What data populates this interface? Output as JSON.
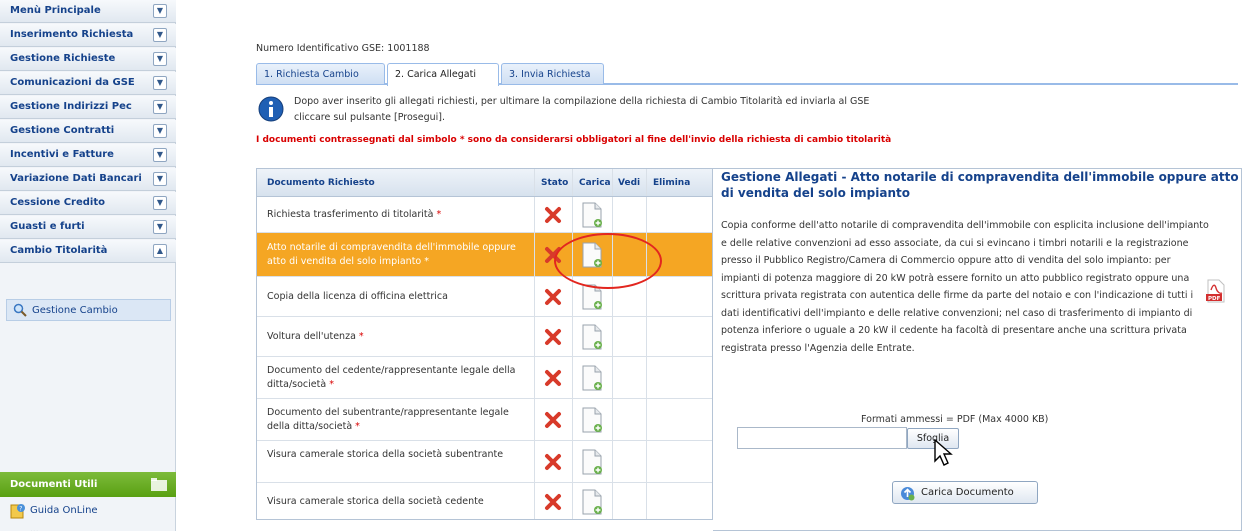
{
  "sidebar": {
    "items": [
      {
        "label": "Menù Principale",
        "expand": "▼"
      },
      {
        "label": "Inserimento Richiesta",
        "expand": "▼"
      },
      {
        "label": "Gestione Richieste",
        "expand": "▼"
      },
      {
        "label": "Comunicazioni da GSE",
        "expand": "▼"
      },
      {
        "label": "Gestione Indirizzi Pec",
        "expand": "▼"
      },
      {
        "label": "Gestione Contratti",
        "expand": "▼"
      },
      {
        "label": "Incentivi e Fatture",
        "expand": "▼"
      },
      {
        "label": "Variazione Dati Bancari",
        "expand": "▼"
      },
      {
        "label": "Cessione Credito",
        "expand": "▼"
      },
      {
        "label": "Guasti e furti",
        "expand": "▼"
      },
      {
        "label": "Cambio Titolarità",
        "expand": "▲"
      }
    ],
    "subitem": "Gestione Cambio",
    "docs_header": "Documenti Utili",
    "guide_link": "Guida OnLine",
    "extra_link": "..."
  },
  "main": {
    "gse_id": "Numero Identificativo GSE: 1001188",
    "tabs": [
      {
        "label": "1. Richiesta Cambio"
      },
      {
        "label": "2. Carica Allegati"
      },
      {
        "label": "3. Invia Richiesta"
      }
    ],
    "info_line1": "Dopo aver inserito gli allegati richiesti, per ultimare la compilazione della richiesta di Cambio Titolarità ed inviarla al GSE",
    "info_line2": "cliccare sul pulsante [Prosegui].",
    "notice": "I documenti contrassegnati dal simbolo * sono da considerarsi obbligatori al fine dell'invio della richiesta di cambio titolarità"
  },
  "table": {
    "headers": {
      "doc": "Documento Richiesto",
      "stato": "Stato",
      "carica": "Carica",
      "vedi": "Vedi",
      "elimina": "Elimina"
    },
    "rows": [
      {
        "doc": "Richiesta trasferimento di titolarità",
        "req": " *"
      },
      {
        "doc": "Atto notarile di compravendita dell'immobile oppure atto di vendita del solo impianto",
        "req": " *"
      },
      {
        "doc": "Copia della licenza di officina elettrica",
        "req": ""
      },
      {
        "doc": "Voltura dell'utenza",
        "req": " *"
      },
      {
        "doc": "Documento del cedente/rappresentante legale della ditta/società",
        "req": " *"
      },
      {
        "doc": "Documento del subentrante/rappresentante legale della ditta/società",
        "req": " *"
      },
      {
        "doc": "Visura camerale storica della società subentrante",
        "req": ""
      },
      {
        "doc": "Visura camerale storica della società cedente",
        "req": ""
      }
    ]
  },
  "panel": {
    "title": "Gestione Allegati - Atto notarile di compravendita dell'immobile oppure atto di vendita del solo impianto",
    "body": "Copia conforme dell'atto notarile di compravendita dell'immobile con esplicita inclusione dell'impianto e delle relative convenzioni ad esso associate, da cui si evincano i timbri notarili e la registrazione presso il Pubblico Registro/Camera di Commercio oppure atto di vendita del solo impianto: per impianti di potenza maggiore di 20 kW potrà essere fornito un atto pubblico registrato oppure una scrittura privata registrata con autentica delle firme da parte del notaio e con l'indicazione di tutti i dati identificativi dell'impianto e delle relative convenzioni; nel caso di trasferimento di impianto di potenza inferiore o uguale a 20 kW il cedente ha facoltà di presentare anche una scrittura privata registrata presso l'Agenzia delle Entrate.",
    "formats": "Formati ammessi = PDF (Max 4000 KB)",
    "file_value": "",
    "browse_label": "Sfoglia",
    "upload_label": "Carica Documento"
  },
  "colors": {
    "accent": "#15428b",
    "selected_row": "#f5a623",
    "required": "#d90000",
    "highlight_circle": "#e2261f"
  }
}
